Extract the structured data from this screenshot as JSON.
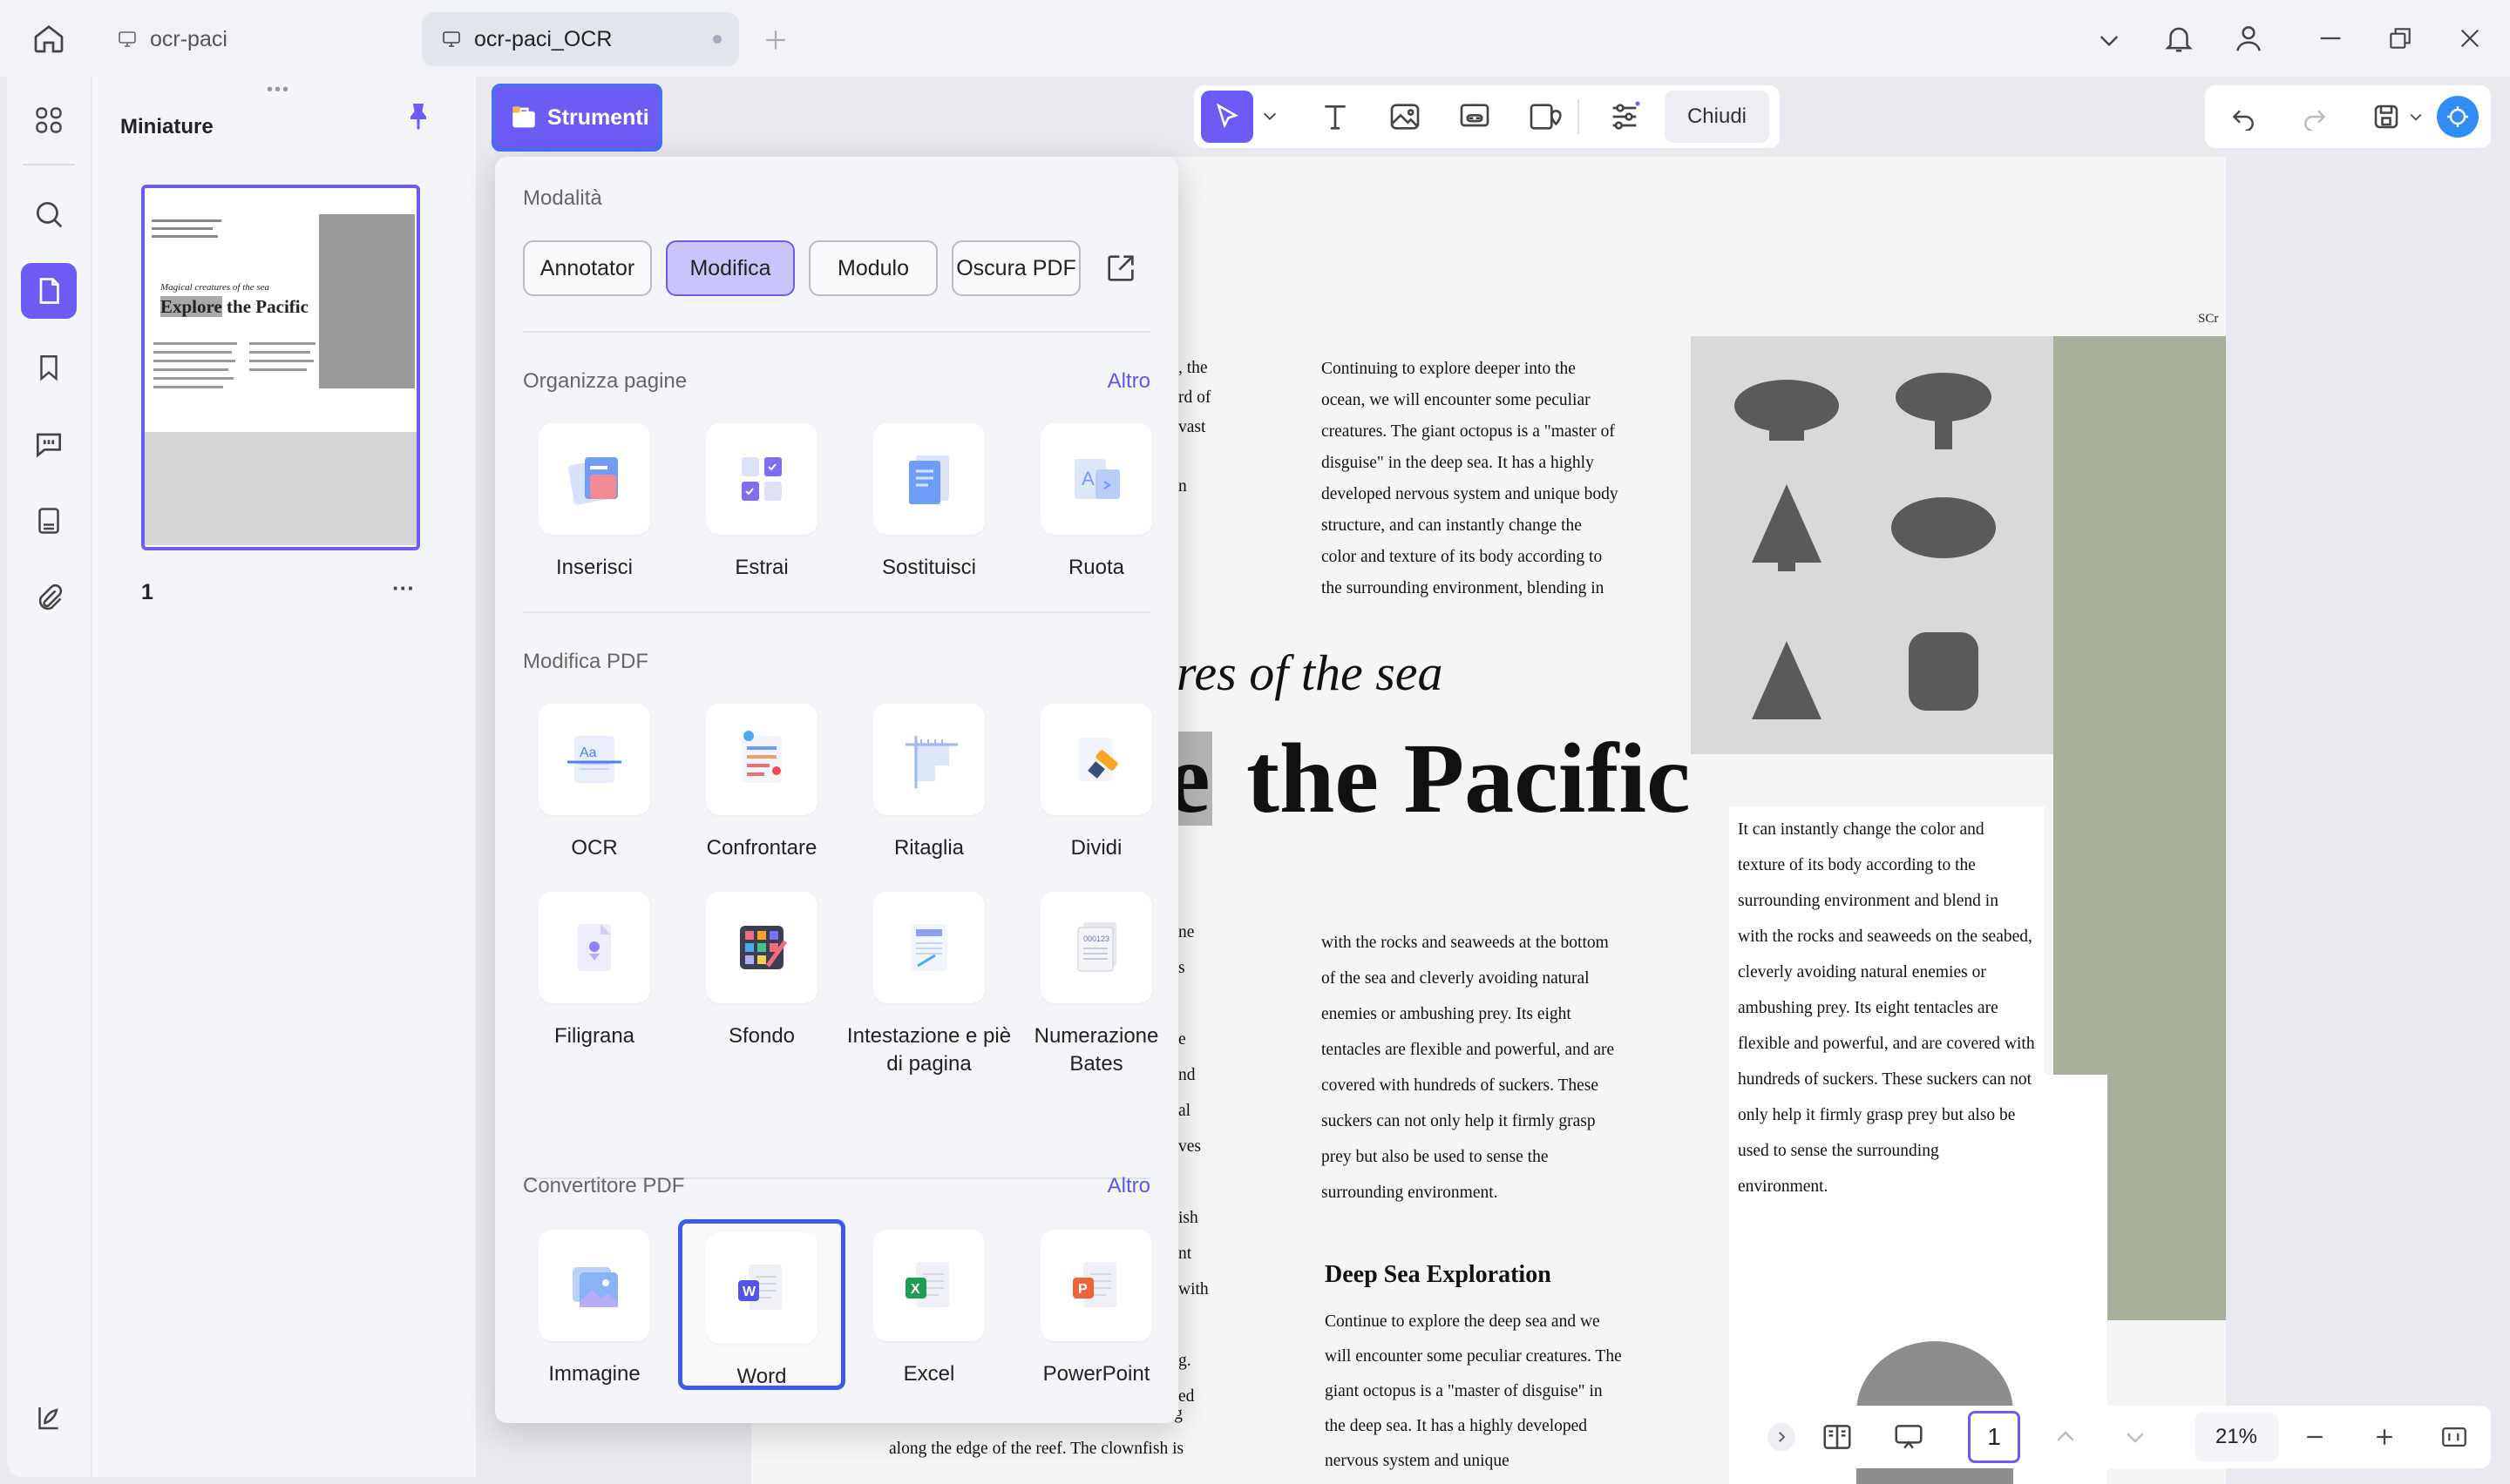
{
  "tabs": [
    {
      "label": "ocr-paci",
      "active": false
    },
    {
      "label": "ocr-paci_OCR",
      "active": true
    }
  ],
  "thumbnails": {
    "title": "Miniature",
    "page_number": "1",
    "more": "···"
  },
  "toolbar": {
    "strumenti_label": "Strumenti",
    "close_label": "Chiudi"
  },
  "panel": {
    "modes_title": "Modalità",
    "modes": [
      "Annotator",
      "Modifica",
      "Modulo",
      "Oscura PDF"
    ],
    "active_mode": "Modifica",
    "organize": {
      "title": "Organizza pagine",
      "more": "Altro",
      "tools": [
        "Inserisci",
        "Estrai",
        "Sostituisci",
        "Ruota"
      ]
    },
    "edit": {
      "title": "Modifica PDF",
      "tools": [
        "OCR",
        "Confrontare",
        "Ritaglia",
        "Dividi",
        "Filigrana",
        "Sfondo",
        "Intestazione e piè di pagina",
        "Numerazione Bates"
      ]
    },
    "convert": {
      "title": "Convertitore PDF",
      "more": "Altro",
      "tools": [
        "Immagine",
        "Word",
        "Excel",
        "PowerPoint"
      ],
      "selected": "Word"
    }
  },
  "document": {
    "subtitle_fragment": "res of the sea",
    "title_fragment": "the Pacific",
    "title_cut_letter": "e",
    "small_label": "SCr",
    "col_left_top": [
      ", the",
      "rd of",
      "vast",
      "",
      "n"
    ],
    "col_mid_top": [
      "Continuing to explore deeper into the",
      "ocean, we will encounter some peculiar",
      "creatures. The giant octopus is a \"master of",
      "disguise\" in the deep sea. It has a highly",
      "developed nervous system and unique body",
      "structure, and can instantly change the",
      "color and texture of its body according to",
      "the surrounding environment, blending in"
    ],
    "col_mid_mid": [
      "with the rocks and seaweeds at the bottom",
      "of the sea and cleverly avoiding natural",
      "enemies or ambushing prey. Its eight",
      "tentacles are flexible and powerful, and are",
      "covered with hundreds of suckers. These",
      "suckers can not only help it firmly grasp",
      "prey but also be used to sense the",
      "surrounding environment."
    ],
    "deep_sea_heading": "Deep Sea Exploration",
    "col_mid_bottom": [
      "Continue to explore the deep sea and we",
      "will encounter some peculiar creatures. The",
      "giant octopus is a \"master of disguise\" in",
      "the deep sea. It has a highly developed",
      "nervous system and unique"
    ],
    "col_right": [
      "It can instantly change the color and",
      "texture of its body according to the",
      "surrounding environment and blend in",
      "with the rocks and seaweeds on the seabed,",
      "cleverly avoiding natural enemies or",
      "ambushing prey. Its eight tentacles are",
      "flexible and powerful, and are covered with",
      "hundreds of suckers. These suckers can not",
      "only help it firmly grasp prey but also be",
      "used to sense the surrounding",
      "environment."
    ],
    "col_left_bottom": [
      "with unique patterns, and leisurely cruising",
      "along the edge of the reef. The clownfish is"
    ],
    "col_left_fragments": [
      "ne",
      "s",
      "",
      "e",
      "nd",
      "al",
      "ves",
      "",
      "ish",
      "nt",
      "with",
      "",
      "g.",
      "ed"
    ]
  },
  "bottom": {
    "page": "1",
    "zoom": "21%"
  },
  "thumb_text": {
    "subtitle": "Magical creatures of the sea",
    "title_a": "Explore",
    "title_b": " the Pacific"
  }
}
